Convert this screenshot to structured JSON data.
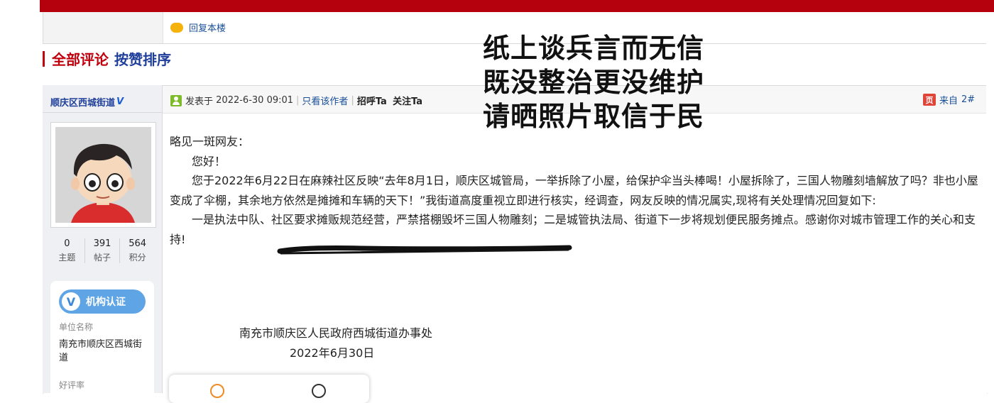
{
  "reply": {
    "label": "回复本楼"
  },
  "section": {
    "all_comments": "全部评论",
    "sort_by_likes": "按赞排序"
  },
  "overlay_lines": [
    "纸上谈兵言而无信",
    "既没整治更没维护",
    "请晒照片取信于民"
  ],
  "author": {
    "name": "顺庆区西城街道",
    "verified_mark": "V",
    "stats": [
      {
        "value": "0",
        "label": "主题"
      },
      {
        "value": "391",
        "label": "帖子"
      },
      {
        "value": "564",
        "label": "积分"
      }
    ],
    "cert_badge": "机构认证",
    "unit_key": "单位名称",
    "unit_value": "南充市顺庆区西城街道",
    "rating_key": "好评率"
  },
  "post": {
    "posted_prefix": "发表于",
    "posted_time": "2022-6-30 09:01",
    "only_author": "只看该作者",
    "greet": "招呼Ta",
    "follow": "关注Ta",
    "floor_source": "来自",
    "floor_number": "2#",
    "floor_icon_text": "页",
    "salutation": "略见一斑网友：",
    "hello": "您好！",
    "para1": "您于2022年6月22日在麻辣社区反映“去年8月1日，顺庆区城管局，一举拆除了小屋，给保护伞当头棒喝！小屋拆除了，三国人物雕刻墙解放了吗？非也小屋变成了伞棚，其余地方依然是摊摊和车辆的天下！”我街道高度重视立即进行核实，经调查，网友反映的情况属实,现将有关处理情况回复如下:",
    "para2_a": "一是执法中队、",
    "para2_emph": "社区要求摊贩规范经营，严禁搭棚毁坏三国人物雕刻",
    "para2_b": "；二是城管执法局、街道下一步将规划便民服务摊点。感谢你对城市管理工作的关心和支持!",
    "signature_org": "南充市顺庆区人民政府西城街道办事处",
    "signature_date": "2022年6月30日"
  },
  "icons": {
    "reply": "comment-bubble-icon",
    "user": "user-icon",
    "floor": "mobile-source-icon",
    "cert": "verified-v-icon",
    "like": "smile-icon",
    "react": "face-icon"
  },
  "colors": {
    "brand_red": "#b5000e",
    "link_blue": "#1a4f9a",
    "header_red": "#c0000c",
    "header_blue": "#1f3f9a"
  }
}
